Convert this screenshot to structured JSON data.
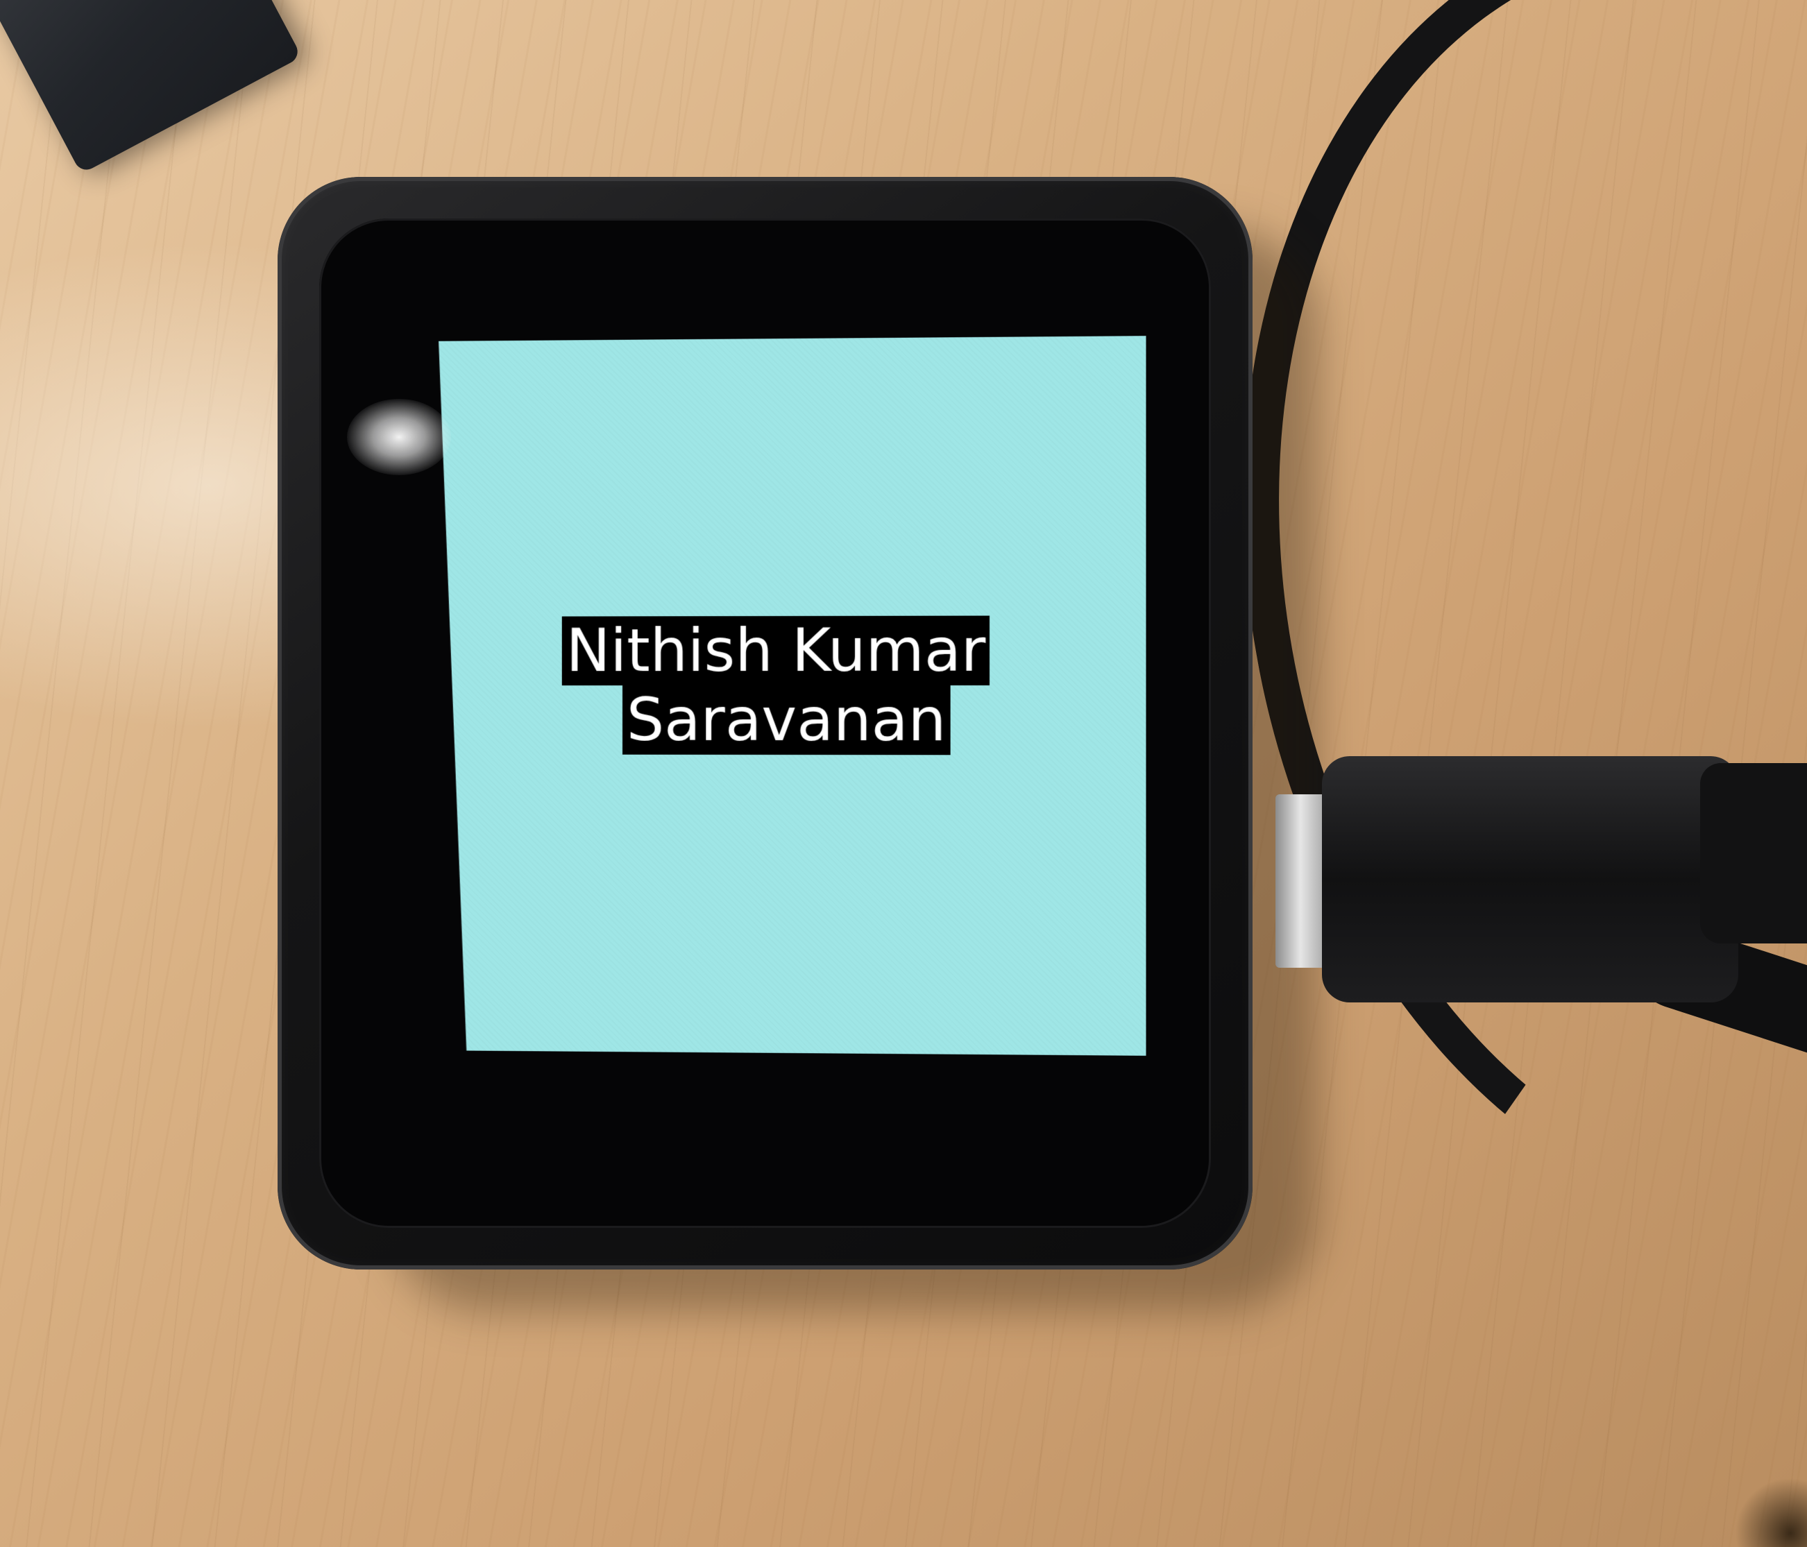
{
  "screen": {
    "background_color": "#9fe6e6",
    "text_color": "#ffffff",
    "highlight_color": "#000000",
    "name_line_1": "Nithish Kumar",
    "name_line_2": "Saravanan"
  },
  "objects": {
    "device_color": "#111112",
    "table_color": "#d9b184",
    "cable_color": "#121213"
  }
}
